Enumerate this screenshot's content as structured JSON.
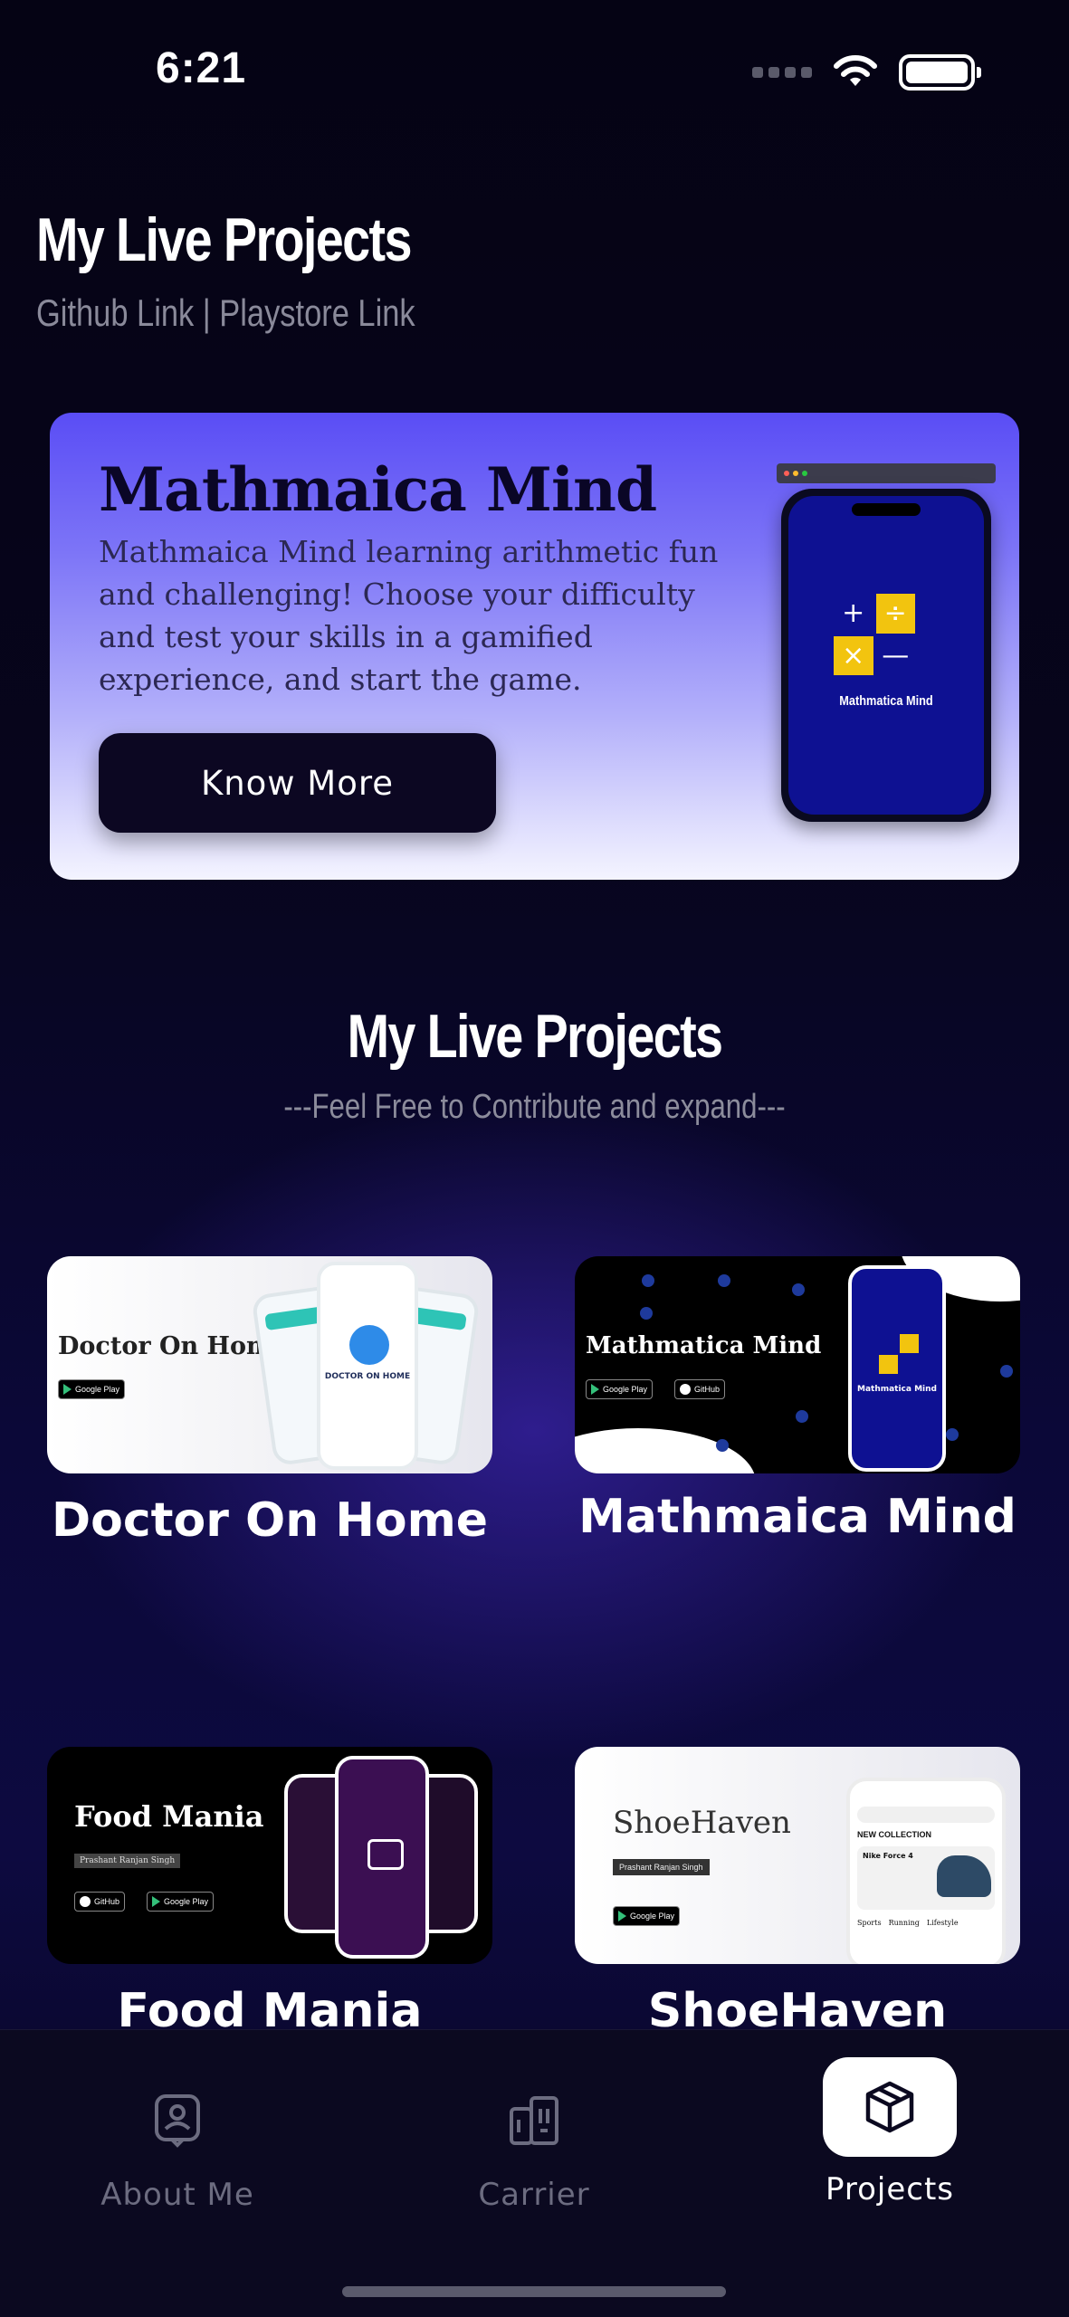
{
  "status_bar": {
    "time": "6:21"
  },
  "header": {
    "title": "My Live Projects",
    "subtitle": "Github Link | Playstore Link"
  },
  "hero": {
    "title": "Mathmaica Mind",
    "description": "Mathmaica Mind learning arithmetic fun and challenging! Choose your difficulty and test your skills in a gamified experience, and start the game.",
    "button": "Know More",
    "phone_screen_label": "Mathmatica Mind"
  },
  "section": {
    "title": "My Live Projects",
    "subtitle": "---Feel Free to Contribute and expand---"
  },
  "projects": [
    {
      "name": "Doctor On Home",
      "thumb_title": "Doctor On Home",
      "thumb_phone_text": "DOCTOR ON HOME"
    },
    {
      "name": "Mathmaica Mind",
      "thumb_title": "Mathmatica Mind",
      "thumb_phone_text": "Mathmatica Mind"
    },
    {
      "name": "Food Mania",
      "thumb_title": "Food Mania",
      "thumb_author": "Prashant Ranjan Singh"
    },
    {
      "name": "ShoeHaven",
      "thumb_title": "ShoeHaven",
      "thumb_author": "Prashant Ranjan Singh",
      "thumb_collection": "NEW COLLECTION",
      "thumb_product": "Nike Force 4",
      "thumb_tabs": [
        "Sports",
        "Running",
        "Lifestyle"
      ]
    }
  ],
  "badges": {
    "google_play": "Google Play",
    "github": "GitHub"
  },
  "tabs": [
    {
      "label": "About Me",
      "icon": "person-badge-icon"
    },
    {
      "label": "Carrier",
      "icon": "building-icon"
    },
    {
      "label": "Projects",
      "icon": "package-box-icon"
    }
  ],
  "colors": {
    "background": "#07051c",
    "hero_top": "#5a4df5",
    "button": "#0c0722",
    "active_tab": "#ffffff"
  }
}
